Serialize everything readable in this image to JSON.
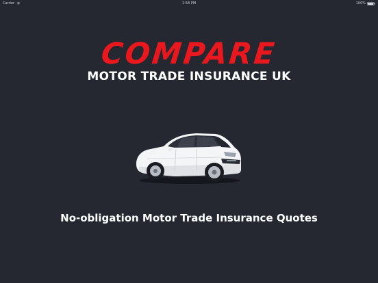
{
  "status_bar": {
    "carrier": "Carrier",
    "time": "1:58 PM",
    "battery": "100%"
  },
  "logo": {
    "brand": "COMPARE",
    "subtitle": "MOTOR TRADE INSURANCE UK"
  },
  "tagline": "No-obligation Motor Trade Insurance Quotes",
  "colors": {
    "background": "#252830",
    "brand_red": "#e8181e",
    "text": "#ffffff"
  },
  "icons": {
    "car": "car-icon",
    "wifi": "wifi-icon",
    "battery": "battery-icon"
  }
}
